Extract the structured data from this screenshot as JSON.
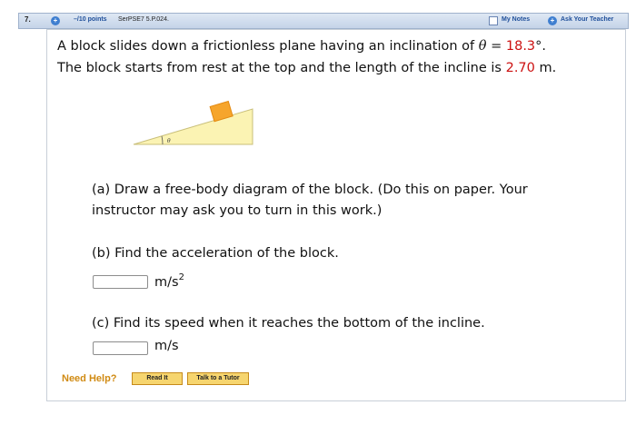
{
  "header": {
    "question_number": "7.",
    "points": "–/10 points",
    "problem_code": "SerPSE7 5.P.024.",
    "my_notes": "My Notes",
    "ask_teacher": "Ask Your Teacher"
  },
  "problem": {
    "line1_start": "A block slides down a frictionless plane having an inclination of ",
    "theta_symbol": "θ",
    "equals": " = ",
    "angle_value": "18.3",
    "angle_unit": "°.",
    "line2_start": "The block starts from rest at the top and the length of the incline is ",
    "length_value": "2.70",
    "length_unit": " m.",
    "diagram_angle_label": "θ"
  },
  "parts": {
    "a_line1": "(a) Draw a free-body diagram of the block. (Do this on paper. Your",
    "a_line2": "instructor may ask you to turn in this work.)",
    "b_prompt": "(b) Find the acceleration of the block.",
    "b_value": "",
    "b_unit": "m/s",
    "b_unit_exp": "2",
    "c_prompt": "(c) Find its speed when it reaches the bottom of the incline.",
    "c_value": "",
    "c_unit": "m/s"
  },
  "help": {
    "label": "Need Help?",
    "read_it": "Read It",
    "talk_tutor": "Talk to a Tutor"
  },
  "colors": {
    "header_blue": "#1f4f9a",
    "given_red": "#cc1111",
    "incline_fill": "#fbf3b3",
    "block_orange": "#f6a52c",
    "help_orange": "#d08a12",
    "button_fill": "#f6d56f"
  }
}
